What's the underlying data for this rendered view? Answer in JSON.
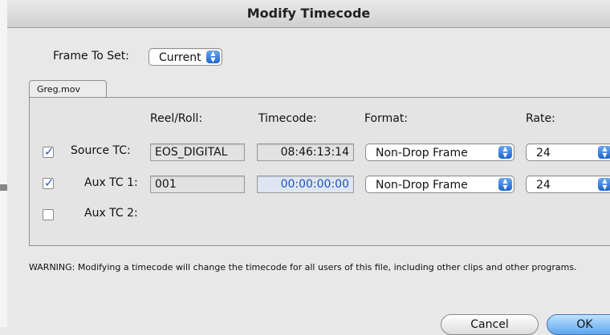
{
  "window": {
    "title": "Modify Timecode"
  },
  "frame_to_set": {
    "label": "Frame To Set:",
    "value": "Current"
  },
  "tab": {
    "label": "Greg.mov"
  },
  "columns": {
    "reel": "Reel/Roll:",
    "timecode": "Timecode:",
    "format": "Format:",
    "rate": "Rate:"
  },
  "rows": [
    {
      "label": "Source TC:",
      "checked": true,
      "reel": "EOS_DIGITAL",
      "timecode": "08:46:13:14",
      "format": "Non-Drop Frame",
      "rate": "24"
    },
    {
      "label": "Aux TC 1:",
      "checked": true,
      "reel": "001",
      "timecode": "00:00:00:00",
      "format": "Non-Drop Frame",
      "rate": "24"
    },
    {
      "label": "Aux TC 2:",
      "checked": false
    }
  ],
  "warning": "WARNING: Modifying a timecode will change the timecode for all users of this file, including other clips and other programs.",
  "buttons": {
    "cancel": "Cancel",
    "ok": "OK"
  },
  "icons": {
    "checkmark": "checkmark-icon",
    "stepper": "popup-stepper-icon"
  },
  "colors": {
    "accent": "#1f64cf",
    "active_text": "#1b53c6"
  }
}
